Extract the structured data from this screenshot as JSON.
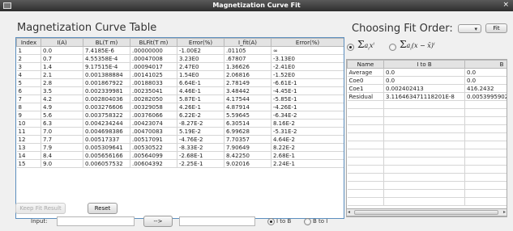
{
  "window": {
    "title": "Magnetization Curve Fit",
    "close_glyph": "×"
  },
  "left_panel": {
    "heading": "Magnetization Curve Table",
    "columns": [
      "Index",
      "I(A)",
      "BL(T m)",
      "BLFit(T m)",
      "Error(%)",
      "I_fit(A)",
      "Error(%)"
    ],
    "rows": [
      [
        "1",
        "0.0",
        "7.4185E-6",
        ".00000000",
        "-1.00E2",
        ".01105",
        "∞"
      ],
      [
        "2",
        "0.7",
        "4.55358E-4",
        ".00047008",
        "3.23E0",
        ".67807",
        "-3.13E0"
      ],
      [
        "3",
        "1.4",
        "9.17515E-4",
        ".00094017",
        "2.47E0",
        "1.36626",
        "-2.41E0"
      ],
      [
        "4",
        "2.1",
        "0.001388884",
        ".00141025",
        "1.54E0",
        "2.06816",
        "-1.52E0"
      ],
      [
        "5",
        "2.8",
        "0.001867922",
        ".00188033",
        "6.64E-1",
        "2.78149",
        "-6.61E-1"
      ],
      [
        "6",
        "3.5",
        "0.002339981",
        ".00235041",
        "4.46E-1",
        "3.48442",
        "-4.45E-1"
      ],
      [
        "7",
        "4.2",
        "0.002804036",
        ".00282050",
        "5.87E-1",
        "4.17544",
        "-5.85E-1"
      ],
      [
        "8",
        "4.9",
        "0.003276606",
        ".00329058",
        "4.26E-1",
        "4.87914",
        "-4.26E-1"
      ],
      [
        "9",
        "5.6",
        "0.003758322",
        ".00376066",
        "6.22E-2",
        "5.59645",
        "-6.34E-2"
      ],
      [
        "10",
        "6.3",
        "0.004234244",
        ".00423074",
        "-8.27E-2",
        "6.30514",
        "8.16E-2"
      ],
      [
        "11",
        "7.0",
        "0.004698386",
        ".00470083",
        "5.19E-2",
        "6.99628",
        "-5.31E-2"
      ],
      [
        "12",
        "7.7",
        "0.00517337",
        ".00517091",
        "-4.76E-2",
        "7.70357",
        "4.64E-2"
      ],
      [
        "13",
        "7.9",
        "0.005309641",
        ".00530522",
        "-8.33E-2",
        "7.90649",
        "8.22E-2"
      ],
      [
        "14",
        "8.4",
        "0.005656166",
        ".00564099",
        "-2.68E-1",
        "8.42250",
        "2.68E-1"
      ],
      [
        "15",
        "9.0",
        "0.006057532",
        ".00604392",
        "-2.25E-1",
        "9.02016",
        "2.24E-1"
      ]
    ],
    "keep_fit_label": "Keep Fit Result",
    "reset_label": "Reset",
    "input_label": "Input:",
    "input_value": "",
    "arrow_button_label": "-->",
    "output_value": "",
    "radio_i_to_b": "I to B",
    "radio_b_to_i": "B to I",
    "radio_selected": "I to B"
  },
  "right_panel": {
    "heading": "Choosing Fit Order:",
    "dropdown_value": "",
    "fit_label": "Fit",
    "formula_selected": "power",
    "columns": [
      "Name",
      "I to B",
      "B"
    ],
    "rows": [
      [
        "Average",
        "0.0",
        "0.0"
      ],
      [
        "Coe0",
        "0.0",
        "0.0"
      ],
      [
        "Coe1",
        "0.002402413",
        "416.2432"
      ],
      [
        "Residual",
        "3.116463471118201E-8",
        "0.0053995902"
      ]
    ],
    "empty_row_count": 13
  },
  "icons": {
    "dropdown_arrow": "▾",
    "scroll_left": "◂",
    "scroll_right": "▸"
  }
}
